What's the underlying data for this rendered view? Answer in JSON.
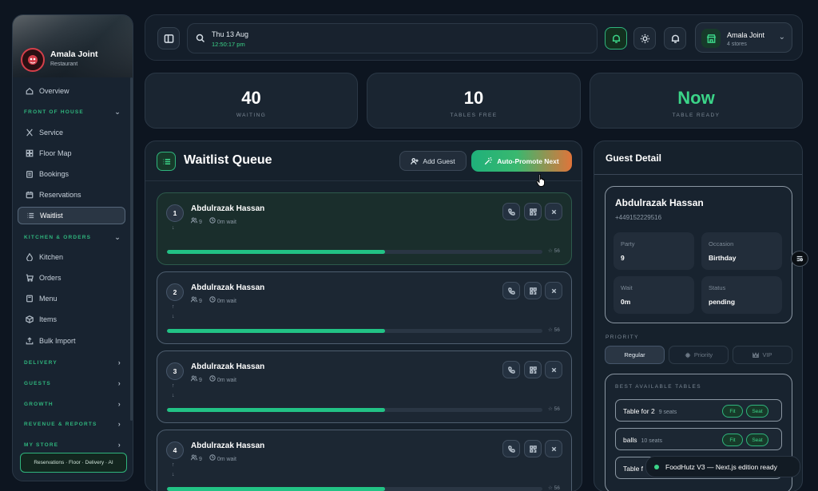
{
  "sidebar": {
    "restaurant_name": "Amala Joint",
    "restaurant_type": "Restaurant",
    "items": {
      "overview": "Overview",
      "service": "Service",
      "floor_map": "Floor Map",
      "bookings": "Bookings",
      "reservations": "Reservations",
      "waitlist": "Waitlist",
      "kitchen": "Kitchen",
      "orders": "Orders",
      "menu": "Menu",
      "items": "Items",
      "bulk_import": "Bulk Import"
    },
    "sections": {
      "front_of_house": "FRONT OF HOUSE",
      "kitchen_orders": "KITCHEN & ORDERS",
      "delivery": "DELIVERY",
      "guests": "GUESTS",
      "growth": "GROWTH",
      "revenue_reports": "REVENUE & REPORTS",
      "my_store": "MY STORE"
    },
    "footer": "Reservations · Floor · Delivery · AI"
  },
  "topbar": {
    "date": "Thu 13 Aug",
    "time": "12:50:17 pm",
    "store_name": "Amala Joint",
    "store_count": "4 stores"
  },
  "stats": [
    {
      "value": "40",
      "label": "WAITING"
    },
    {
      "value": "10",
      "label": "TABLES FREE"
    },
    {
      "value": "Now",
      "label": "TABLE READY"
    }
  ],
  "queue": {
    "title": "Waitlist Queue",
    "add_guest": "Add Guest",
    "auto_promote": "Auto-Promote Next",
    "entries": [
      {
        "num": "1",
        "name": "Abdulrazak Hassan",
        "party": "9",
        "wait": "0m wait",
        "score": "56",
        "progress": 0.58
      },
      {
        "num": "2",
        "name": "Abdulrazak Hassan",
        "party": "9",
        "wait": "0m wait",
        "score": "56",
        "progress": 0.58
      },
      {
        "num": "3",
        "name": "Abdulrazak Hassan",
        "party": "9",
        "wait": "0m wait",
        "score": "56",
        "progress": 0.58
      },
      {
        "num": "4",
        "name": "Abdulrazak Hassan",
        "party": "9",
        "wait": "0m wait",
        "score": "56",
        "progress": 0.58
      }
    ]
  },
  "detail": {
    "title": "Guest Detail",
    "name": "Abdulrazak Hassan",
    "phone": "+449152229516",
    "party_label": "Party",
    "party_value": "9",
    "occasion_label": "Occasion",
    "occasion_value": "Birthday",
    "wait_label": "Wait",
    "wait_value": "0m",
    "status_label": "Status",
    "status_value": "pending",
    "priority_label": "PRIORITY",
    "priority_options": [
      "Regular",
      "Priority",
      "VIP"
    ],
    "tables_label": "BEST AVAILABLE TABLES",
    "tables": [
      {
        "name": "Table for 2",
        "seats": "9 seats",
        "fit": "Fit",
        "seat": "Seat"
      },
      {
        "name": "balls",
        "seats": "10 seats",
        "fit": "Fit",
        "seat": "Seat"
      },
      {
        "name": "Table f",
        "seats": "",
        "fit": "",
        "seat": ""
      }
    ]
  },
  "toast": "FoodHutz V3 — Next.js edition ready"
}
